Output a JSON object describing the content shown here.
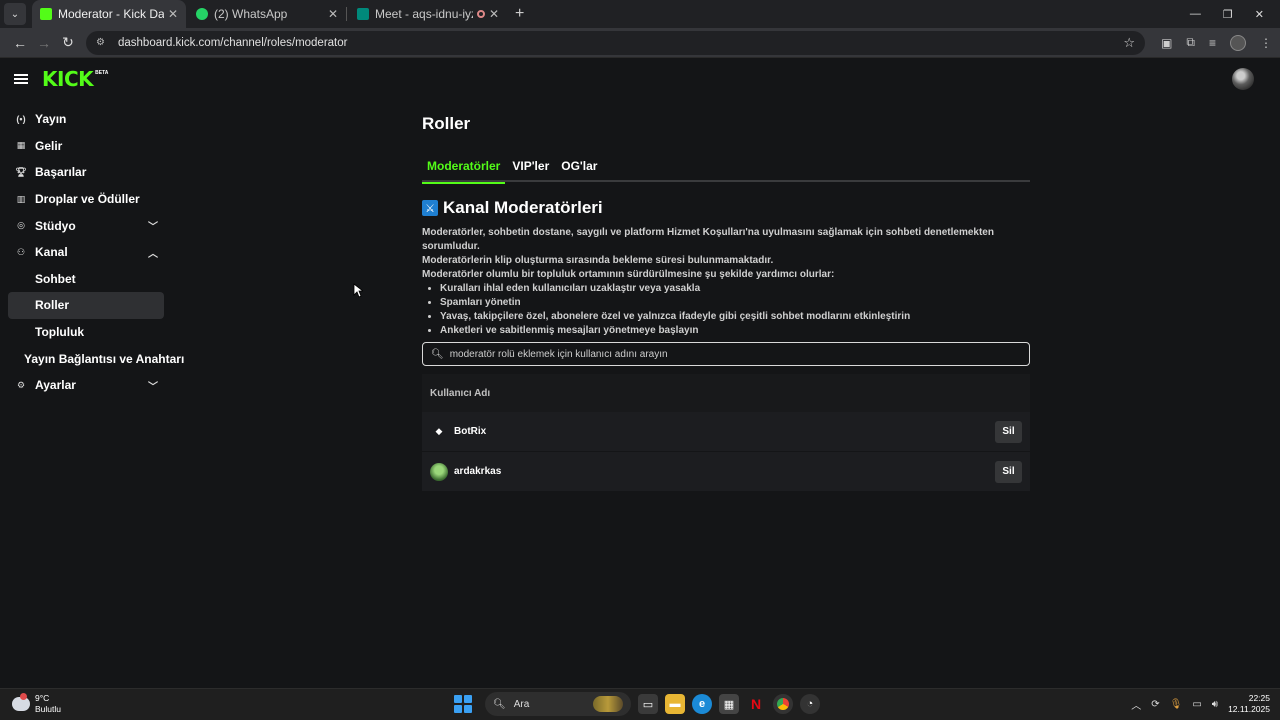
{
  "browser": {
    "tabs": [
      {
        "title": "Moderator - Kick Dashboard",
        "active": true,
        "favicon_color": "#53fc18"
      },
      {
        "title": "(2) WhatsApp",
        "active": false,
        "favicon_color": "#25d366"
      },
      {
        "title": "Meet - aqs-idnu-iyz",
        "active": false,
        "favicon_color": "#00897b"
      }
    ],
    "url": "dashboard.kick.com/channel/roles/moderator"
  },
  "app": {
    "logo": "KICK",
    "logo_badge": "BETA",
    "brand_color": "#53fc18"
  },
  "sidebar": {
    "items": [
      {
        "label": "Yayın",
        "icon": "broadcast-icon"
      },
      {
        "label": "Gelir",
        "icon": "revenue-icon"
      },
      {
        "label": "Başarılar",
        "icon": "trophy-icon"
      },
      {
        "label": "Droplar ve Ödüller",
        "icon": "drops-icon"
      },
      {
        "label": "Stüdyo",
        "icon": "studio-icon",
        "expandable": true
      },
      {
        "label": "Kanal",
        "icon": "channel-icon",
        "expanded": true
      },
      {
        "label": "Sohbet"
      },
      {
        "label": "Roller",
        "selected": true
      },
      {
        "label": "Topluluk"
      },
      {
        "label": "Yayın Bağlantısı ve Anahtarı"
      },
      {
        "label": "Ayarlar",
        "icon": "settings-icon",
        "expandable": true
      }
    ]
  },
  "main": {
    "title": "Roller",
    "tabs": [
      "Moderatörler",
      "VIP'ler",
      "OG'lar"
    ],
    "active_tab": "Moderatörler",
    "section_title": "Kanal Moderatörleri",
    "desc_lines": [
      "Moderatörler, sohbetin dostane, saygılı ve platform Hizmet Koşulları'na uyulmasını sağlamak için sohbeti denetlemekten sorumludur.",
      "Moderatörlerin klip oluşturma sırasında bekleme süresi bulunmamaktadır.",
      "Moderatörler olumlu bir topluluk ortamının sürdürülmesine şu şekilde yardımcı olurlar:"
    ],
    "bullets": [
      "Kuralları ihlal eden kullanıcıları uzaklaştır veya yasakla",
      "Spamları yönetin",
      "Yavaş, takipçilere özel, abonelere özel ve yalnızca ifadeyle gibi çeşitli sohbet modlarını etkinleştirin",
      "Anketleri ve sabitlenmiş mesajları yönetmeye başlayın"
    ],
    "search_placeholder": "moderatör rolü eklemek için kullanıcı adını arayın",
    "table": {
      "header": "Kullanıcı Adı",
      "rows": [
        {
          "username": "BotRix",
          "action": "Sil"
        },
        {
          "username": "ardakrkas",
          "action": "Sil"
        }
      ]
    }
  },
  "taskbar": {
    "weather_temp": "9°C",
    "weather_desc": "Bulutlu",
    "search_label": "Ara",
    "time": "22:25",
    "date": "12.11.2025"
  }
}
